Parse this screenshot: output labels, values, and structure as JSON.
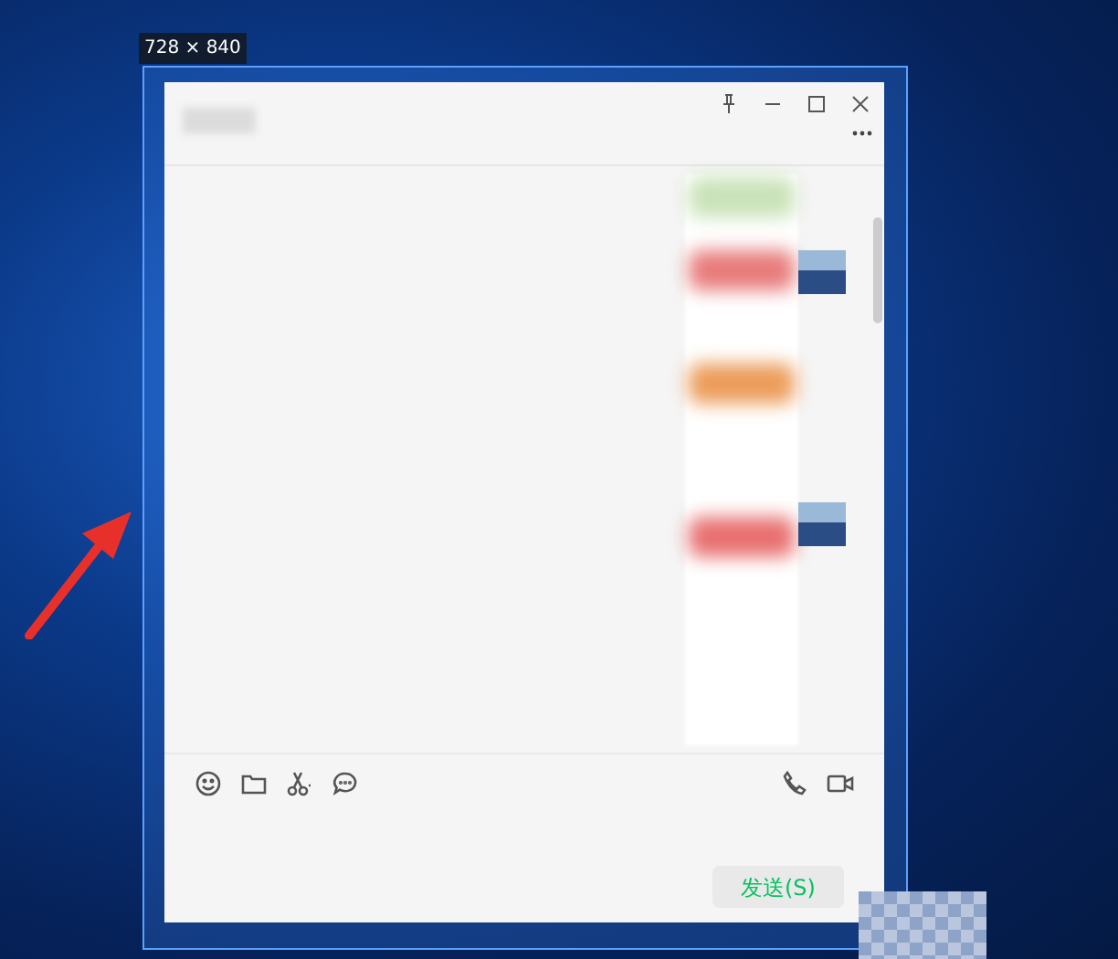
{
  "selection_label": "728 × 840",
  "composer": {
    "send_button": "发送(S)"
  }
}
